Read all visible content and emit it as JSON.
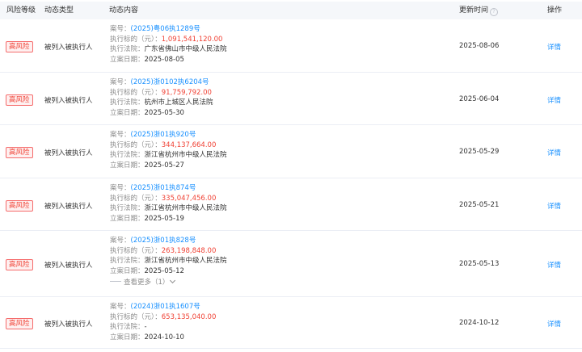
{
  "header": {
    "risk_level": "风险等级",
    "event_type": "动态类型",
    "content": "动态内容",
    "update_time": "更新时间",
    "help_glyph": "?",
    "operation": "操作"
  },
  "labels": {
    "case_no": "案号：",
    "amount": "执行标的（元）：",
    "court": "执行法院：",
    "filing_date": "立案日期：",
    "detail": "详情"
  },
  "rows": [
    {
      "risk": "高风险",
      "type": "被列入被执行人",
      "case_no": "(2025)粤06执1289号",
      "amount": "1,091,541,120.00",
      "court": "广东省佛山市中级人民法院",
      "filing_date": "2025-08-05",
      "update_time": "2025-08-06"
    },
    {
      "risk": "高风险",
      "type": "被列入被执行人",
      "case_no": "(2025)浙0102执6204号",
      "amount": "91,759,792.00",
      "court": "杭州市上城区人民法院",
      "filing_date": "2025-05-30",
      "update_time": "2025-06-04"
    },
    {
      "risk": "高风险",
      "type": "被列入被执行人",
      "case_no": "(2025)浙01执920号",
      "amount": "344,137,664.00",
      "court": "浙江省杭州市中级人民法院",
      "filing_date": "2025-05-27",
      "update_time": "2025-05-29"
    },
    {
      "risk": "高风险",
      "type": "被列入被执行人",
      "case_no": "(2025)浙01执874号",
      "amount": "335,047,456.00",
      "court": "浙江省杭州市中级人民法院",
      "filing_date": "2025-05-19",
      "update_time": "2025-05-21"
    },
    {
      "risk": "高风险",
      "type": "被列入被执行人",
      "case_no": "(2025)浙01执828号",
      "amount": "263,198,848.00",
      "court": "浙江省杭州市中级人民法院",
      "filing_date": "2025-05-12",
      "update_time": "2025-05-13",
      "more": "查看更多（1）"
    },
    {
      "risk": "高风险",
      "type": "被列入被执行人",
      "case_no": "(2024)浙01执1607号",
      "amount": "653,135,040.00",
      "court": "-",
      "filing_date": "2024-10-10",
      "update_time": "2024-10-12"
    }
  ]
}
